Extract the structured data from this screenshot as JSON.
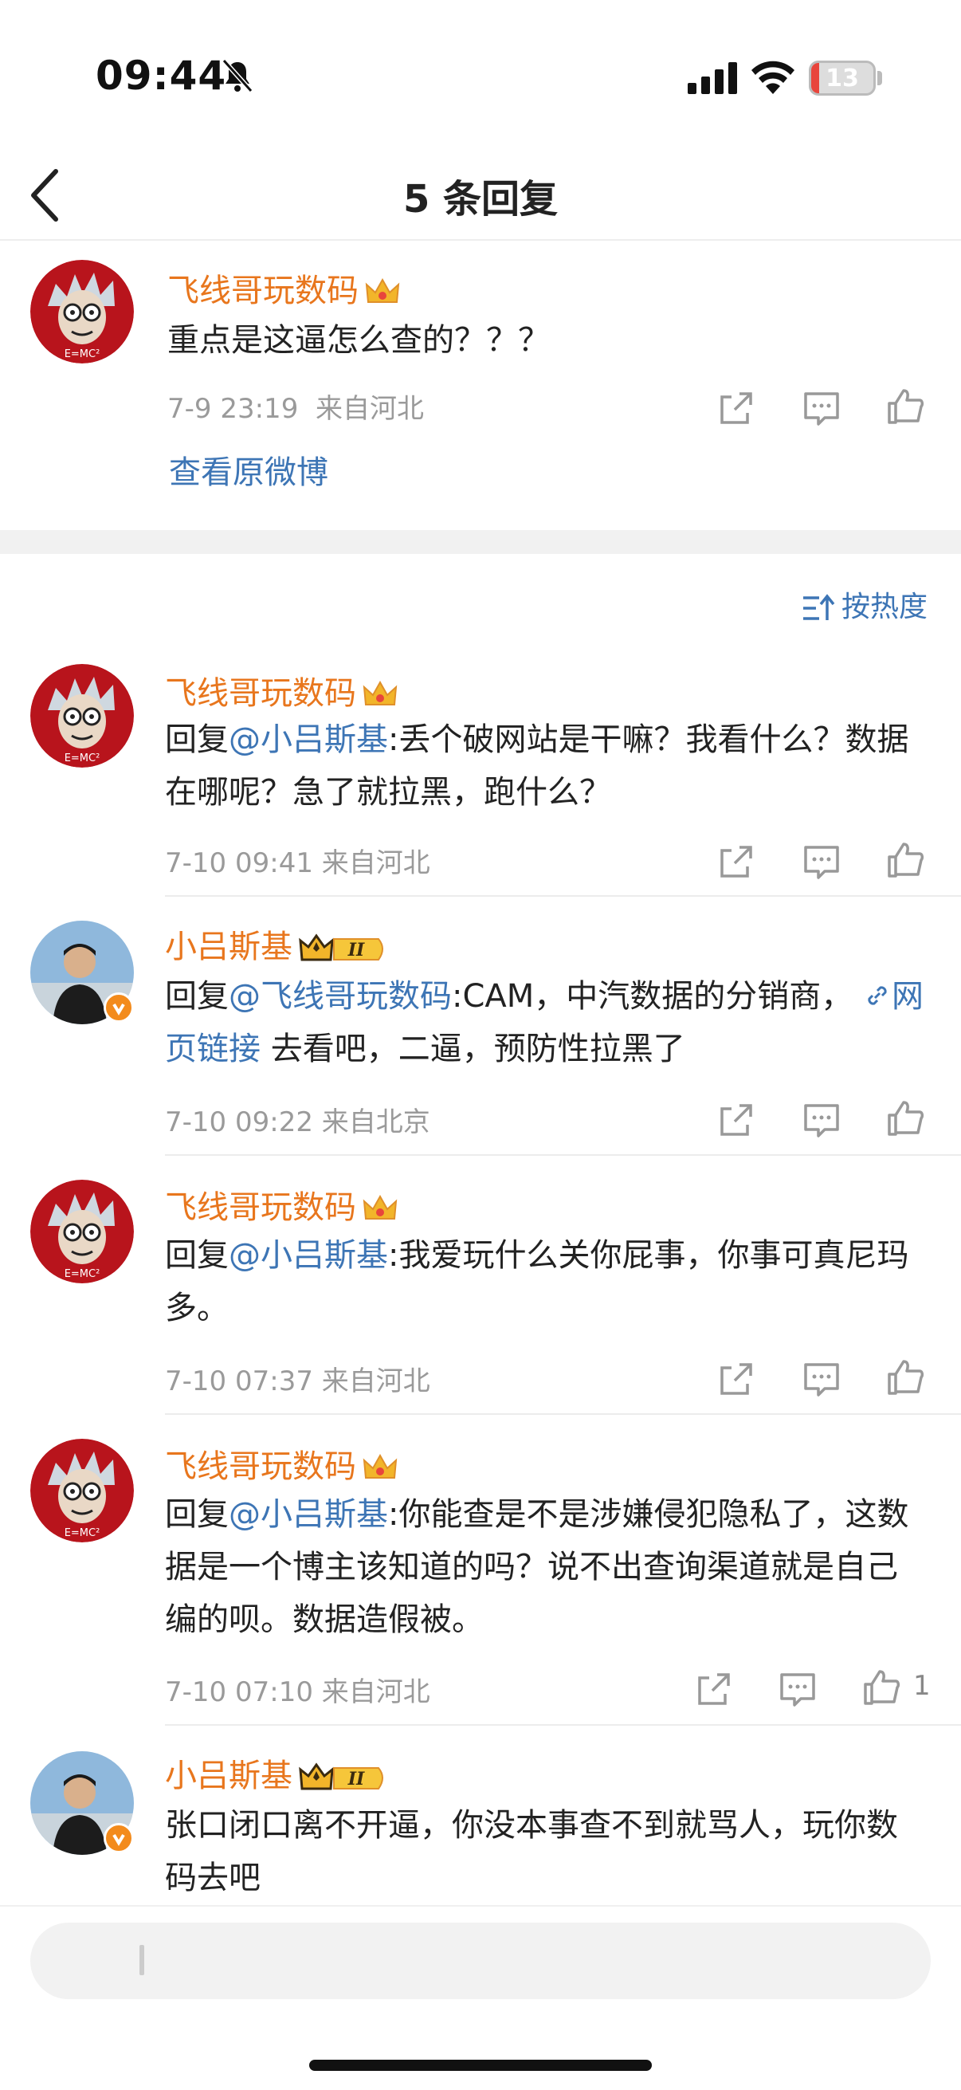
{
  "status": {
    "time": "09:44",
    "battery": "13",
    "battery_level": 0.13
  },
  "nav": {
    "title": "5 条回复",
    "back_icon": "chevron-left-icon"
  },
  "original": {
    "user": "飞线哥玩数码",
    "text": "重点是这逼怎么查的？？？",
    "time": "7-9 23:19",
    "location": "来自河北",
    "view_link": "查看原微博"
  },
  "sort": {
    "label": "按热度"
  },
  "replies": [
    {
      "user": "飞线哥玩数码",
      "prefix": "回复",
      "mention": "@小吕斯基",
      "body": ":丢个破网站是干嘛？我看什么？数据在哪呢？急了就拉黑，跑什么？",
      "time": "7-10 09:41",
      "location": "来自河北",
      "likes": ""
    },
    {
      "user": "小吕斯基",
      "prefix": "回复",
      "mention": "@飞线哥玩数码",
      "body": ":CAM，中汽数据的分销商，",
      "link": "网页链接",
      "after": " 去看吧，二逼，预防性拉黑了",
      "time": "7-10 09:22",
      "location": "来自北京",
      "likes": "",
      "level": "II"
    },
    {
      "user": "飞线哥玩数码",
      "prefix": "回复",
      "mention": "@小吕斯基",
      "body": ":我爱玩什么关你屁事，你事可真尼玛多。",
      "time": "7-10 07:37",
      "location": "来自河北",
      "likes": ""
    },
    {
      "user": "飞线哥玩数码",
      "prefix": "回复",
      "mention": "@小吕斯基",
      "body": ":你能查是不是涉嫌侵犯隐私了，这数据是一个博主该知道的吗？说不出查询渠道就是自己编的呗。数据造假被。",
      "time": "7-10 07:10",
      "location": "来自河北",
      "likes": "1"
    },
    {
      "user": "小吕斯基",
      "text": "张口闭口离不开逼，你没本事查不到就骂人，玩你数码去吧",
      "level": "II"
    }
  ],
  "colors": {
    "accent_blue": "#3d75b5",
    "name_orange": "#e8761d",
    "battery_red": "#e8453c"
  }
}
